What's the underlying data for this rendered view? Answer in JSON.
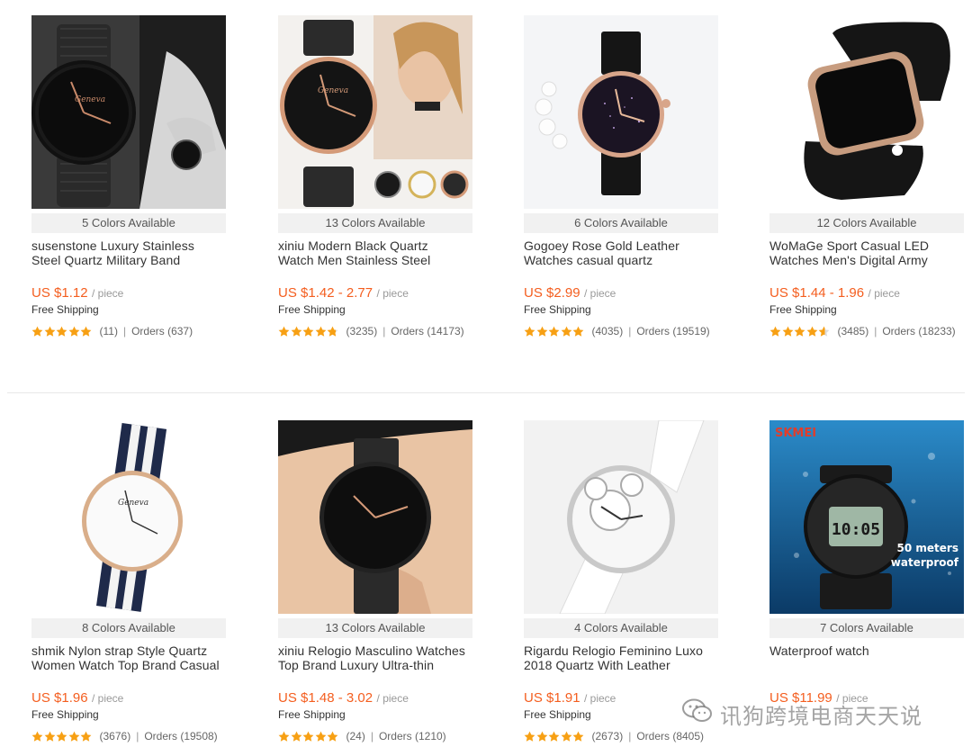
{
  "colors": {
    "price": "#f45e1f",
    "star": "#f7a014",
    "badge_bg": "#f1f1f1"
  },
  "products": [
    {
      "image_icon": "wristwatch-black-mesh",
      "colors_available": "5 Colors Available",
      "title_line1": "susenstone Luxury Stainless",
      "title_line2": "Steel Quartz Military Band",
      "price": "US $1.12",
      "per": "/ piece",
      "shipping": "Free Shipping",
      "rating": 5,
      "reviews": "(11)",
      "sep": "|",
      "orders": "Orders (637)"
    },
    {
      "image_icon": "wristwatch-black-rosegold",
      "colors_available": "13 Colors Available",
      "title_line1": "xiniu Modern Black Quartz",
      "title_line2": "Watch Men Stainless Steel",
      "price": "US $1.42 - 2.77",
      "per": "/ piece",
      "shipping": "Free Shipping",
      "rating": 4.8,
      "reviews": "(3235)",
      "sep": "|",
      "orders": "Orders (14173)"
    },
    {
      "image_icon": "wristwatch-starry-dial",
      "colors_available": "6 Colors Available",
      "title_line1": "Gogoey Rose Gold Leather",
      "title_line2": "Watches casual quartz",
      "price": "US $2.99",
      "per": "/ piece",
      "shipping": "Free Shipping",
      "rating": 5,
      "reviews": "(4035)",
      "sep": "|",
      "orders": "Orders (19519)"
    },
    {
      "image_icon": "led-digital-watch",
      "colors_available": "12 Colors Available",
      "title_line1": "WoMaGe Sport Casual LED",
      "title_line2": "Watches Men's Digital Army",
      "price": "US $1.44 - 1.96",
      "per": "/ piece",
      "shipping": "Free Shipping",
      "rating": 4.6,
      "reviews": "(3485)",
      "sep": "|",
      "orders": "Orders (18233)"
    },
    {
      "image_icon": "wristwatch-nylon-strap",
      "colors_available": "8 Colors Available",
      "title_line1": "shmik Nylon strap Style Quartz",
      "title_line2": "Women Watch Top Brand Casual",
      "price": "US $1.96",
      "per": "/ piece",
      "shipping": "Free Shipping",
      "rating": 5,
      "reviews": "(3676)",
      "sep": "|",
      "orders": "Orders (19508)"
    },
    {
      "image_icon": "wristwatch-on-wrist",
      "colors_available": "13 Colors Available",
      "title_line1": "xiniu Relogio Masculino Watches",
      "title_line2": "Top Brand Luxury Ultra-thin",
      "price": "US $1.48 - 3.02",
      "per": "/ piece",
      "shipping": "Free Shipping",
      "rating": 5,
      "reviews": "(24)",
      "sep": "|",
      "orders": "Orders (1210)"
    },
    {
      "image_icon": "wristwatch-white-hollow",
      "colors_available": "4 Colors Available",
      "title_line1": "Rigardu Relogio Feminino Luxo",
      "title_line2": "2018 Quartz With Leather",
      "price": "US $1.91",
      "per": "/ piece",
      "shipping": "Free Shipping",
      "rating": 5,
      "reviews": "(2673)",
      "sep": "|",
      "orders": "Orders (8405)"
    },
    {
      "image_icon": "waterproof-sport-watch",
      "image_text_brand": "SKMEI",
      "image_text_time": "10:05",
      "image_text_line1": "50 meters",
      "image_text_line2": "waterproof",
      "colors_available": "7 Colors Available",
      "title_line1": "Waterproof watch",
      "title_line2": "",
      "price": "US $11.99",
      "per": "/ piece",
      "shipping": "",
      "rating": 0,
      "reviews": "",
      "sep": "",
      "orders": ""
    }
  ],
  "watermark": {
    "icon": "wechat-icon",
    "text": "讯狗跨境电商天天说"
  }
}
